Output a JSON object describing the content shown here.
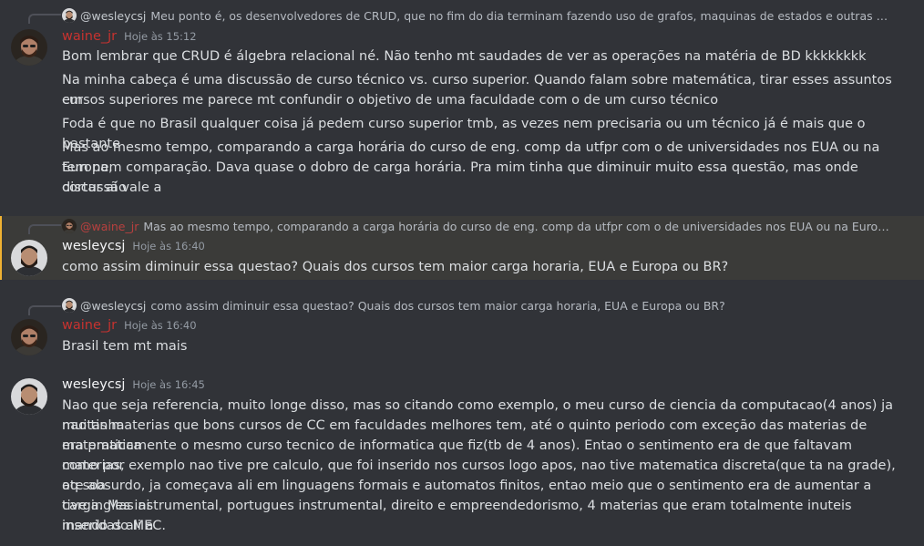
{
  "messages": [
    {
      "reply": {
        "author": "@wesleycsj",
        "text": "Meu ponto é, os desenvolvedores de CRUD, que no fim do dia terminam fazendo uso de grafos, maquinas de estados e outras estruturas..."
      },
      "author": "waine_jr",
      "timestamp": "Hoje às 15:12",
      "lines": [
        "Bom lembrar que CRUD é álgebra relacional né. Não tenho mt saudades de ver as operações na matéria de BD kkkkkkkk",
        "Na minha cabeça é uma discussão de curso técnico vs. curso superior. Quando falam sobre matemática, tirar esses assuntos em",
        "cursos superiores me parece mt confundir o objetivo de uma faculdade com o de um curso técnico",
        "Foda é que no Brasil qualquer coisa já pedem curso superior tmb, as vezes nem precisaria ou um técnico já é mais que o bastante",
        "Mas ao mesmo tempo, comparando a carga horária do curso de eng. comp da utfpr com o de universidades nos EUA ou na Europa,",
        "tem nem comparação. Dava quase o dobro de carga horária. Pra mim tinha que diminuir muito essa questão, mas onde cortar aí vale a",
        "discussão"
      ]
    },
    {
      "reply": {
        "author": "@waine_jr",
        "text": "Mas ao mesmo tempo, comparando a carga horária do curso de eng. comp da utfpr com o de universidades nos EUA ou na Europa, tem n..."
      },
      "author": "wesleycsj",
      "timestamp": "Hoje às 16:40",
      "lines": [
        "como assim diminuir essa questao? Quais dos cursos tem maior carga horaria, EUA e Europa ou BR?"
      ]
    },
    {
      "reply": {
        "author": "@wesleycsj",
        "text": "como assim diminuir essa questao? Quais dos cursos tem maior carga horaria, EUA e Europa ou BR?"
      },
      "author": "waine_jr",
      "timestamp": "Hoje às 16:40",
      "lines": [
        "Brasil tem mt mais"
      ]
    },
    {
      "author": "wesleycsj",
      "timestamp": "Hoje às 16:45",
      "lines": [
        "Nao que seja referencia, muito longe disso, mas so citando como exemplo, o meu curso de ciencia da computacao(4 anos) ja nao tinha",
        "muitas materias que bons cursos de CC em faculdades melhores tem, até o quinto periodo com exceção das materias de matematica",
        "era praticamente o mesmo curso tecnico de informatica que fiz(tb de 4 anos). Entao o sentimento era de que faltavam materias,",
        "como por exemplo nao tive pre calculo, que foi inserido nos cursos logo apos, nao tive matematica discreta(que ta na grade), oq soa",
        "ate absurdo, ja começava ali em linguagens formais e automatos finitos, entao meio que o sentimento era de aumentar a carga. Mas ai",
        "tive ingles instrumental, portugues instrumental, direito e empreendedorismo, 4 materias que eram totalmente inuteis inseridas ali a",
        "mando do MEC."
      ]
    }
  ],
  "colors": {
    "background": "#313338",
    "highlight_background": "#3b3b39",
    "highlight_bar": "#f0b232",
    "waine_name": "#c7322f",
    "wesley_name": "#f2f3f5",
    "text": "#dbdee1",
    "muted": "#949ba4"
  }
}
